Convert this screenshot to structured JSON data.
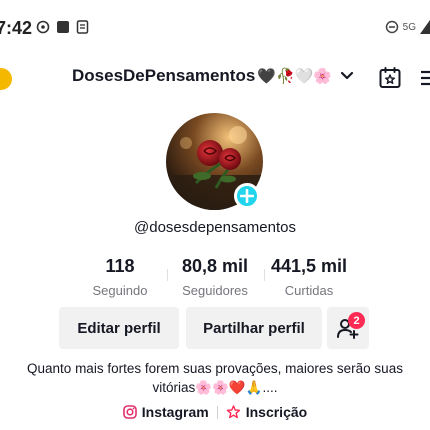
{
  "status_bar": {
    "time": "7:42",
    "network": "5G"
  },
  "header": {
    "username": "DosesDePensamentos",
    "username_emojis": "🖤🥀🤍🌸"
  },
  "profile": {
    "handle": "@dosesdepensamentos",
    "stats": [
      {
        "value": "118",
        "label": "Seguindo"
      },
      {
        "value": "80,8 mil",
        "label": "Seguidores"
      },
      {
        "value": "441,5 mil",
        "label": "Curtidas"
      }
    ]
  },
  "actions": {
    "edit_profile": "Editar perfil",
    "share_profile": "Partilhar perfil",
    "friends_badge_count": "2"
  },
  "bio": {
    "line1": "Quanto mais fortes forem suas provações, maiores serão suas",
    "line2": "vitórias🌸🌸❤️🙏...."
  },
  "links": {
    "instagram": "Instagram",
    "subscription": "Inscrição"
  },
  "colors": {
    "accent_cyan": "#20d5ec",
    "badge_red": "#fe2c55",
    "instagram_pink": "#e1306c",
    "button_bg": "#f1f1f2",
    "muted_text": "#75757d"
  }
}
